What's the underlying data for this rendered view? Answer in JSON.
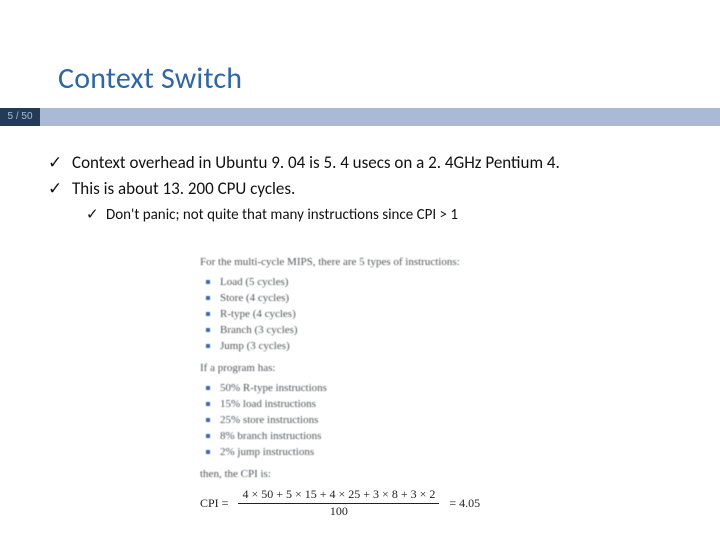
{
  "title": "Context Switch",
  "page": {
    "current": 5,
    "total": 50,
    "label": "5 / 50"
  },
  "bullets": {
    "main": [
      "Context overhead in Ubuntu 9. 04 is 5. 4 usecs on a 2. 4GHz Pentium 4.",
      "This is about 13. 200 CPU cycles."
    ],
    "sub": [
      "Don't panic; not quite that many instructions since CPI > 1"
    ]
  },
  "figure": {
    "lead": "For the multi-cycle MIPS, there are 5 types of instructions:",
    "types": [
      "Load (5 cycles)",
      "Store (4 cycles)",
      "R-type (4 cycles)",
      "Branch (3 cycles)",
      "Jump (3 cycles)"
    ],
    "mid": "If a program has:",
    "mix": [
      "50% R-type instructions",
      "15% load instructions",
      "25% store instructions",
      "8% branch instructions",
      "2% jump instructions"
    ],
    "then": "then, the CPI is:",
    "cpi": {
      "label": "CPI =",
      "num": "4 × 50 + 5 × 15 + 4 × 25 + 3 × 8 + 3 × 2",
      "den": "100",
      "result": "= 4.05"
    }
  }
}
